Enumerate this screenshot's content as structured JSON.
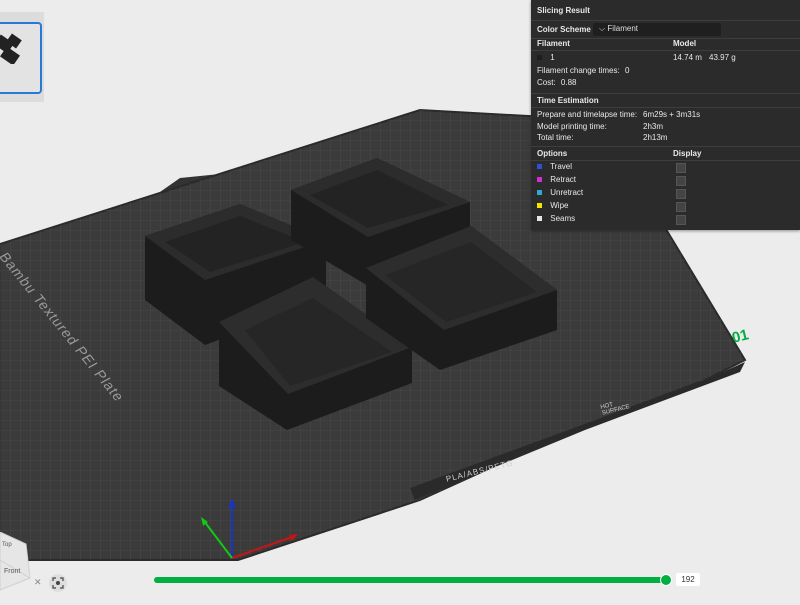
{
  "plate": {
    "brand_label": "Bambu Textured PEI Plate",
    "number": "01",
    "material_tag": "PLA/ABS/PETG",
    "hot_surface_line1": "HOT",
    "hot_surface_line2": "SURFACE"
  },
  "result_panel": {
    "title": "Slicing Result",
    "color_scheme_label": "Color Scheme",
    "color_scheme_value": "Filament",
    "filament_header": "Filament",
    "model_header": "Model",
    "filament_index": "1",
    "filament_length": "14.74 m",
    "filament_weight": "43.97 g",
    "change_times_label": "Filament change times:",
    "change_times_value": "0",
    "cost_label": "Cost:",
    "cost_value": "0.88",
    "time_header": "Time Estimation",
    "prepare_label": "Prepare and timelapse time:",
    "prepare_value": "6m29s + 3m31s",
    "model_time_label": "Model printing time:",
    "model_time_value": "2h3m",
    "total_time_label": "Total time:",
    "total_time_value": "2h13m",
    "options_header": "Options",
    "display_header": "Display",
    "options": [
      {
        "label": "Travel",
        "color": "#2f4fd6"
      },
      {
        "label": "Retract",
        "color": "#d22fd2"
      },
      {
        "label": "Unretract",
        "color": "#2fa8d6"
      },
      {
        "label": "Wipe",
        "color": "#f2e600"
      },
      {
        "label": "Seams",
        "color": "#e6e6e6"
      }
    ]
  },
  "layer_slider": {
    "value": "192",
    "progress": 1.0
  },
  "view_cube": {
    "top_face": "Top",
    "front_face": "Front"
  },
  "colors": {
    "accent": "#00ae42",
    "panel_bg": "#2b2b2b",
    "plate": "#3b3b3b",
    "model": "#1e1e1e"
  },
  "icons": {
    "fit_view": "fit-view-icon",
    "dropdown": "chevron-down-icon"
  }
}
